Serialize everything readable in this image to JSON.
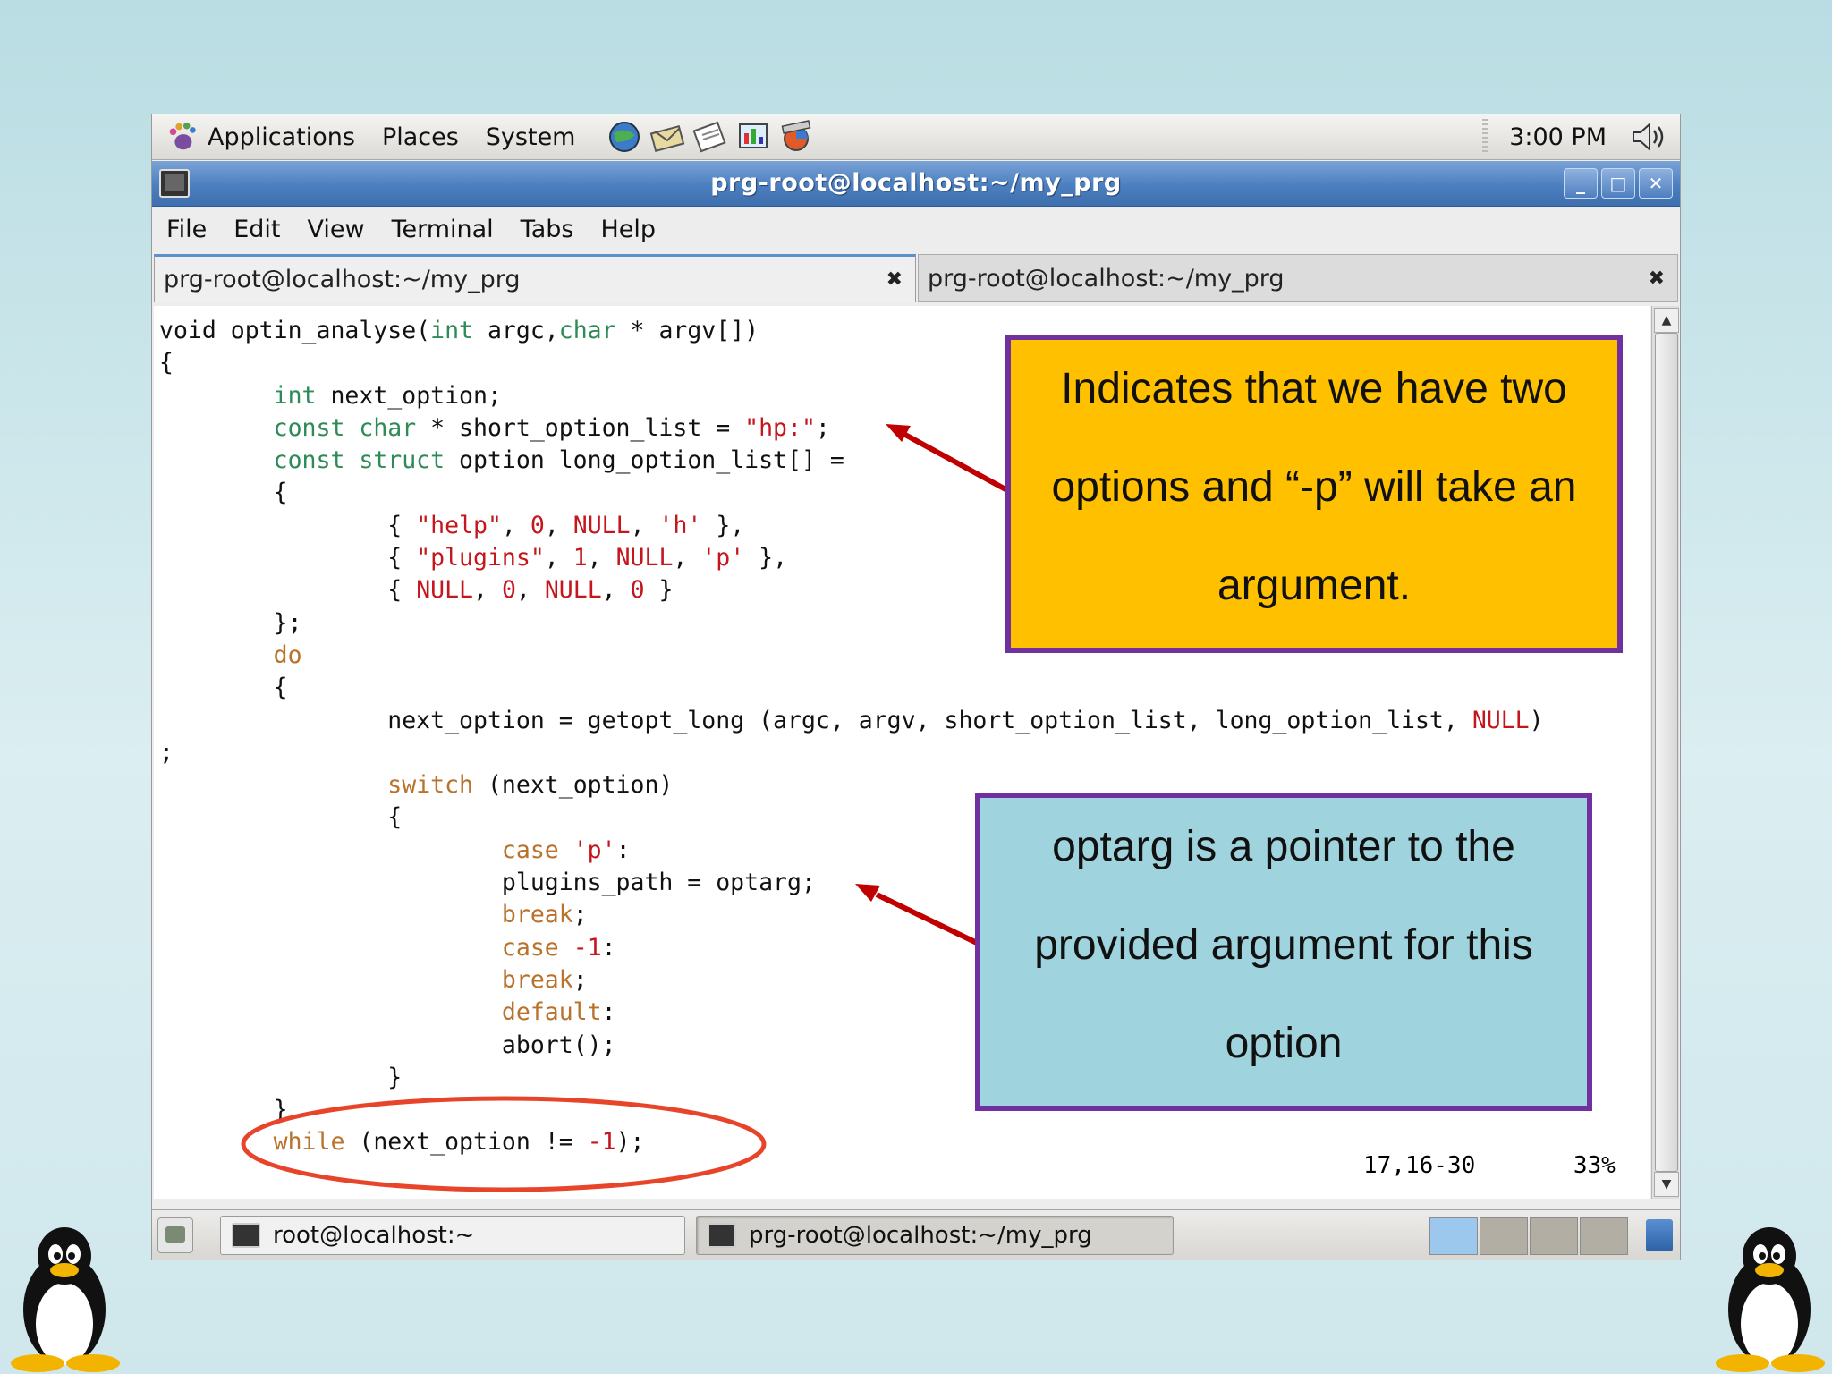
{
  "top_panel": {
    "menus": [
      "Applications",
      "Places",
      "System"
    ],
    "clock": "3:00 PM"
  },
  "window": {
    "title": "prg-root@localhost:~/my_prg",
    "menubar": [
      "File",
      "Edit",
      "View",
      "Terminal",
      "Tabs",
      "Help"
    ],
    "tabs": [
      {
        "label": "prg-root@localhost:~/my_prg",
        "active": true
      },
      {
        "label": "prg-root@localhost:~/my_prg",
        "active": false
      }
    ]
  },
  "terminal": {
    "lines": [
      [
        [
          "void optin_analyse(",
          "p"
        ],
        [
          "int",
          "t"
        ],
        [
          " argc,",
          "p"
        ],
        [
          "char",
          "t"
        ],
        [
          " * argv[])",
          "p"
        ]
      ],
      [
        [
          "{",
          "p"
        ]
      ],
      [
        [
          "        ",
          "p"
        ],
        [
          "int",
          "t"
        ],
        [
          " next_option;",
          "p"
        ]
      ],
      [
        [
          "        ",
          "p"
        ],
        [
          "const char",
          "t"
        ],
        [
          " * short_option_list = ",
          "p"
        ],
        [
          "\"hp:\"",
          "s"
        ],
        [
          ";",
          "p"
        ]
      ],
      [
        [
          "        ",
          "p"
        ],
        [
          "const struct",
          "t"
        ],
        [
          " option long_option_list[] =",
          "p"
        ]
      ],
      [
        [
          "        {",
          "p"
        ]
      ],
      [
        [
          "                { ",
          "p"
        ],
        [
          "\"help\"",
          "s"
        ],
        [
          ", ",
          "p"
        ],
        [
          "0",
          "s"
        ],
        [
          ", ",
          "p"
        ],
        [
          "NULL",
          "s"
        ],
        [
          ", ",
          "p"
        ],
        [
          "'h'",
          "s"
        ],
        [
          " },",
          "p"
        ]
      ],
      [
        [
          "                { ",
          "p"
        ],
        [
          "\"plugins\"",
          "s"
        ],
        [
          ", ",
          "p"
        ],
        [
          "1",
          "s"
        ],
        [
          ", ",
          "p"
        ],
        [
          "NULL",
          "s"
        ],
        [
          ", ",
          "p"
        ],
        [
          "'p'",
          "s"
        ],
        [
          " },",
          "p"
        ]
      ],
      [
        [
          "                { ",
          "p"
        ],
        [
          "NULL",
          "s"
        ],
        [
          ", ",
          "p"
        ],
        [
          "0",
          "s"
        ],
        [
          ", ",
          "p"
        ],
        [
          "NULL",
          "s"
        ],
        [
          ", ",
          "p"
        ],
        [
          "0",
          "s"
        ],
        [
          " }",
          "p"
        ]
      ],
      [
        [
          "        };",
          "p"
        ]
      ],
      [
        [
          "        ",
          "p"
        ],
        [
          "do",
          "c"
        ]
      ],
      [
        [
          "        {",
          "p"
        ]
      ],
      [
        [
          "                next_option = getopt_long (argc, argv, short_option_list, long_option_list, ",
          "p"
        ],
        [
          "NULL",
          "s"
        ],
        [
          ")",
          "p"
        ]
      ],
      [
        [
          ";",
          "p"
        ]
      ],
      [
        [
          "                ",
          "p"
        ],
        [
          "switch",
          "c"
        ],
        [
          " (next_option)",
          "p"
        ]
      ],
      [
        [
          "                {",
          "p"
        ]
      ],
      [
        [
          "                        ",
          "p"
        ],
        [
          "case",
          "c"
        ],
        [
          " ",
          "p"
        ],
        [
          "'p'",
          "s"
        ],
        [
          ":",
          "p"
        ]
      ],
      [
        [
          "                        plugins_path = optarg;",
          "p"
        ]
      ],
      [
        [
          "                        ",
          "p"
        ],
        [
          "break",
          "c"
        ],
        [
          ";",
          "p"
        ]
      ],
      [
        [
          "                        ",
          "p"
        ],
        [
          "case",
          "c"
        ],
        [
          " ",
          "p"
        ],
        [
          "-1",
          "s"
        ],
        [
          ":",
          "p"
        ]
      ],
      [
        [
          "                        ",
          "p"
        ],
        [
          "break",
          "c"
        ],
        [
          ";",
          "p"
        ]
      ],
      [
        [
          "                        ",
          "p"
        ],
        [
          "default",
          "c"
        ],
        [
          ":",
          "p"
        ]
      ],
      [
        [
          "                        abort();",
          "p"
        ]
      ],
      [
        [
          "                }",
          "p"
        ]
      ],
      [
        [
          "        }",
          "p"
        ]
      ],
      [
        [
          "        ",
          "p"
        ],
        [
          "while",
          "c"
        ],
        [
          " (next_option != ",
          "p"
        ],
        [
          "-1",
          "s"
        ],
        [
          ");",
          "p"
        ]
      ]
    ],
    "status_position": "17,16-30",
    "status_percent": "33%",
    "colors": {
      "type": "#2e8b57",
      "control": "#b8722c",
      "string": "#c4161c"
    }
  },
  "taskbar": {
    "tasks": [
      "root@localhost:~",
      "prg-root@localhost:~/my_prg"
    ]
  },
  "callouts": [
    {
      "lines": [
        "Indicates that we have two",
        "options and “-p” will take an",
        "argument."
      ],
      "color": "#ffc000"
    },
    {
      "lines": [
        "optarg is a pointer to the",
        "provided argument for this",
        "option"
      ],
      "color": "#9fd4de"
    }
  ]
}
